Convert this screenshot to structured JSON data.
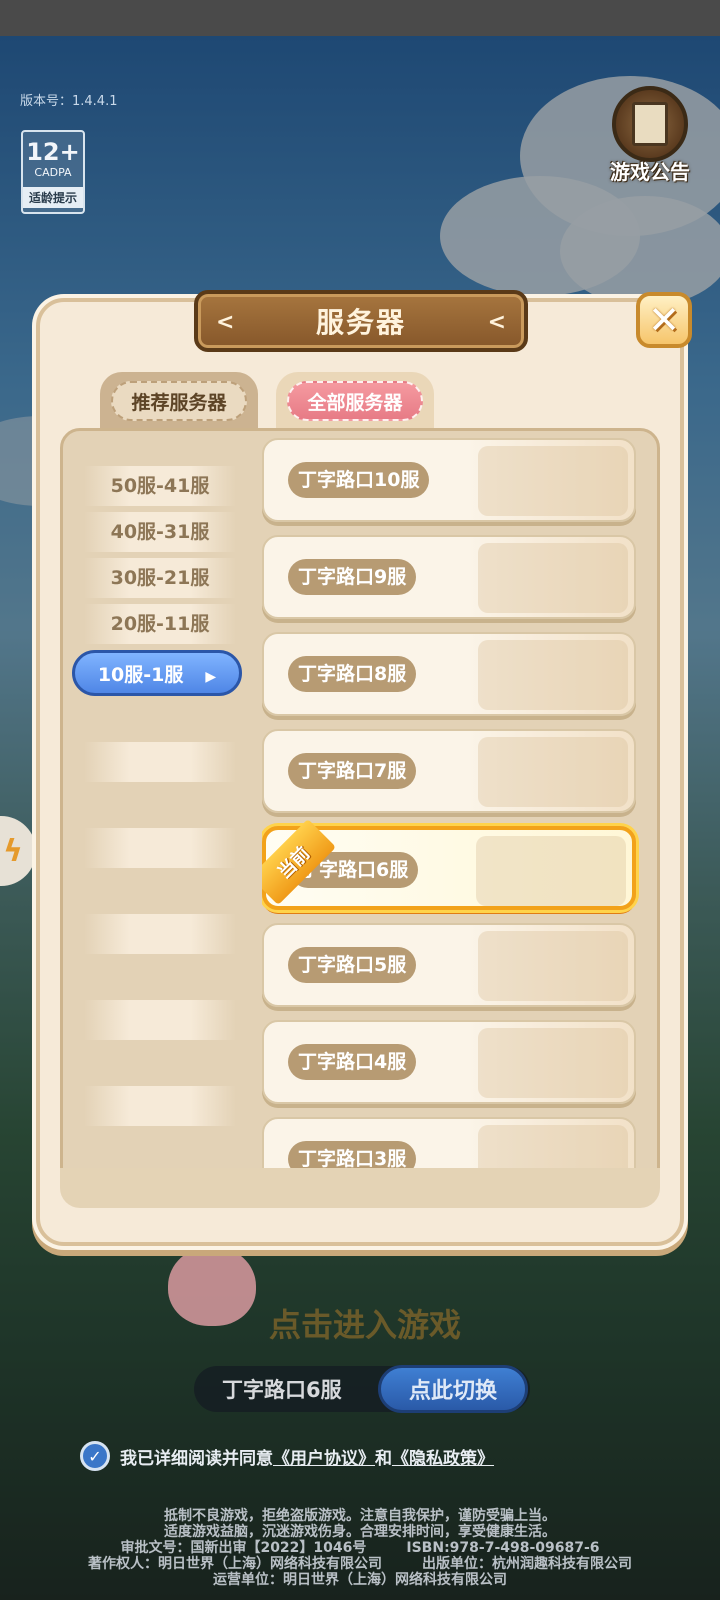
{
  "version": "版本号：1.4.4.1",
  "age_badge": {
    "rating": "12+",
    "org": "CADPA",
    "label": "适龄提示"
  },
  "notice": {
    "label": "游戏公告"
  },
  "dialog": {
    "title": "服务器",
    "tabs": [
      {
        "label": "推荐服务器",
        "selected": false
      },
      {
        "label": "全部服务器",
        "selected": true
      }
    ],
    "ranges": [
      {
        "label": "50服-41服"
      },
      {
        "label": "40服-31服"
      },
      {
        "label": "30服-21服"
      },
      {
        "label": "20服-11服"
      },
      {
        "label": "10服-1服",
        "selected": true
      }
    ],
    "servers": [
      {
        "name": "丁字路口10服"
      },
      {
        "name": "丁字路口9服"
      },
      {
        "name": "丁字路口8服"
      },
      {
        "name": "丁字路口7服"
      },
      {
        "name": "丁字路口6服",
        "current": true,
        "badge": "当前"
      },
      {
        "name": "丁字路口5服"
      },
      {
        "name": "丁字路口4服"
      },
      {
        "name": "丁字路口3服"
      }
    ]
  },
  "enter_game": "点击进入游戏",
  "current_server": "丁字路口6服",
  "switch_button": "点此切换",
  "agreement": {
    "prefix": "我已详细阅读并同意",
    "user": "《用户协议》",
    "and": "和",
    "privacy": "《隐私政策》"
  },
  "legal": {
    "line1": "抵制不良游戏，拒绝盗版游戏。注意自我保护，谨防受骗上当。",
    "line2": "适度游戏益脑，沉迷游戏伤身。合理安排时间，享受健康生活。",
    "approval": "审批文号：国新出审【2022】1046号",
    "isbn": "ISBN:978-7-498-09687-6",
    "copyright": "著作权人：明日世界（上海）网络科技有限公司",
    "publisher": "出版单位：杭州润趣科技有限公司",
    "operator": "运营单位：明日世界（上海）网络科技有限公司"
  },
  "colors": {
    "accent_blue": "#4f86e6",
    "current_orange": "#f2a21a",
    "tab_pink": "#e77b86"
  }
}
